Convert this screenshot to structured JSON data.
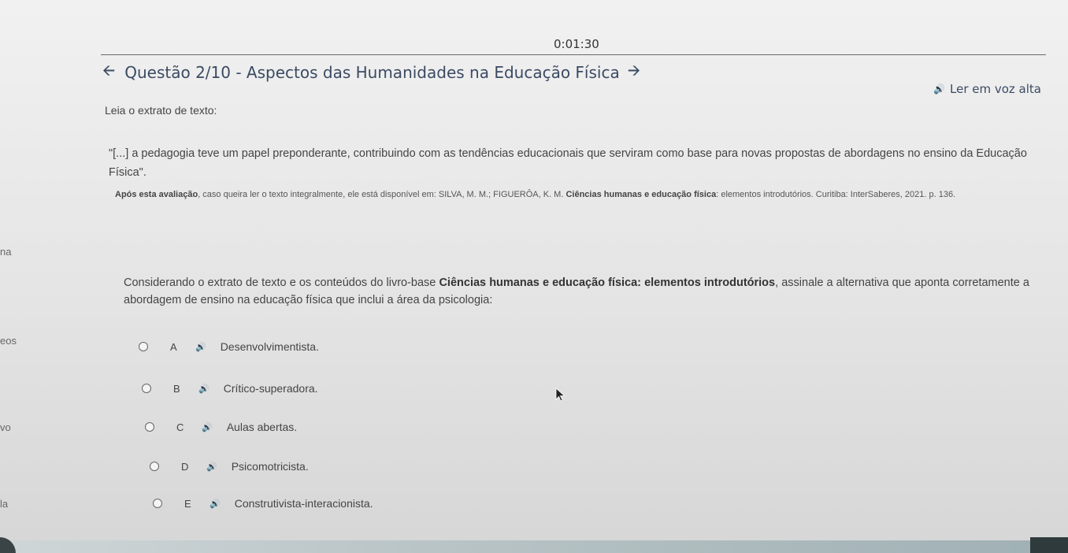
{
  "timer": "0:01:30",
  "header": {
    "title": "Questão 2/10 - Aspectos das Humanidades na Educação Física",
    "prev_icon": "arrow-left-icon",
    "next_icon": "arrow-right-icon",
    "read_aloud_label": "Ler em voz alta"
  },
  "content": {
    "intro": "Leia o extrato de texto:",
    "excerpt": "\"[...] a pedagogia teve um papel preponderante, contribuindo com as tendências educacionais que serviram como base para novas propostas de abordagens no ensino da Educação Física\".",
    "source_bold_1": "Após esta avaliação",
    "source_mid": ", caso queira ler o texto integralmente, ele está disponível em: SILVA, M. M.; FIGUERÔA, K. M. ",
    "source_bold_2": "Ciências humanas e educação física",
    "source_end": ": elementos introdutórios. Curitiba: InterSaberes, 2021. p. 136.",
    "question_pre": "Considerando o extrato de texto e os conteúdos do livro-base ",
    "question_bold": "Ciências humanas e educação física: elementos introdutórios",
    "question_post": ", assinale a alternativa que aponta corretamente a abordagem de ensino na educação física que inclui a área da psicologia:"
  },
  "options": [
    {
      "letter": "A",
      "text": "Desenvolvimentista."
    },
    {
      "letter": "B",
      "text": "Crítico-superadora."
    },
    {
      "letter": "C",
      "text": "Aulas abertas."
    },
    {
      "letter": "D",
      "text": "Psicomotricista."
    },
    {
      "letter": "E",
      "text": "Construtivista-interacionista."
    }
  ],
  "left_fragments": [
    "na",
    "eos",
    "vo",
    "la"
  ]
}
